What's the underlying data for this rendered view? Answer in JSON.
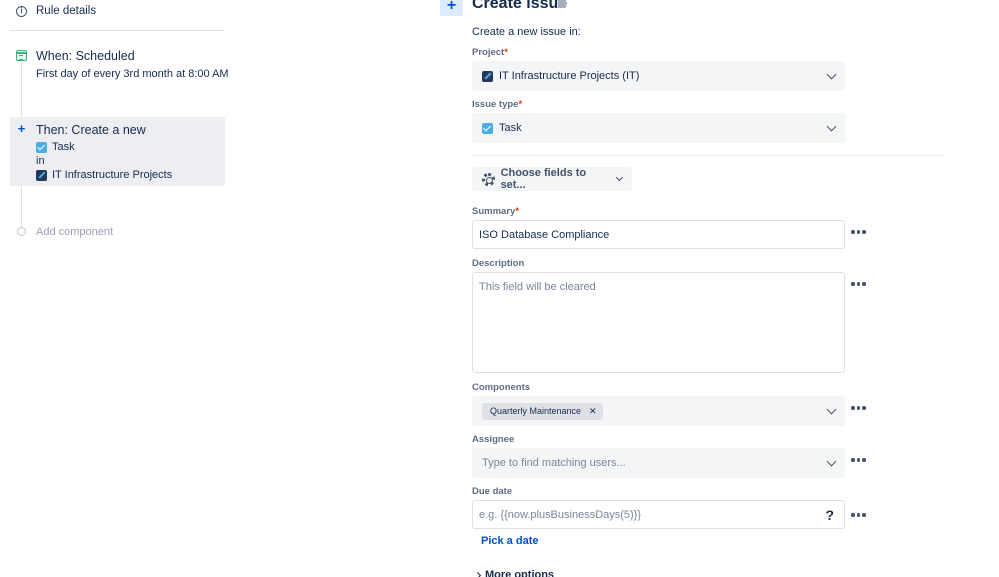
{
  "sidebar": {
    "rule_details": "Rule details",
    "trigger": {
      "title": "When: Scheduled",
      "subtitle": "First day of every 3rd month at 8:00 AM"
    },
    "action": {
      "title": "Then: Create a new",
      "issue_type": "Task",
      "connector": "in",
      "project": "IT Infrastructure Projects"
    },
    "add_component": "Add component"
  },
  "editor": {
    "title": "Create issue",
    "intro": "Create a new issue in:",
    "project": {
      "label": "Project",
      "value": "IT Infrastructure Projects (IT)"
    },
    "issue_type": {
      "label": "Issue type",
      "value": "Task"
    },
    "choose_fields": "Choose fields to set...",
    "summary": {
      "label": "Summary",
      "value": "ISO Database Compliance"
    },
    "description": {
      "label": "Description",
      "placeholder": "This field will be cleared"
    },
    "components": {
      "label": "Components",
      "tags": [
        "Quarterly Maintenance"
      ]
    },
    "assignee": {
      "label": "Assignee",
      "placeholder": "Type to find matching users..."
    },
    "due_date": {
      "label": "Due date",
      "placeholder": "e.g. {{now.plusBusinessDays(5)}}",
      "help": "?"
    },
    "pick_date": "Pick a date",
    "more_options": "More options"
  },
  "required_marker": "*",
  "colors": {
    "accent": "#0052cc",
    "trigger_green": "#36b37e",
    "task_blue": "#4bade8",
    "required_red": "#de350b"
  },
  "icons": [
    "info-icon",
    "calendar-icon",
    "plus-icon",
    "task-icon",
    "project-icon",
    "trash-icon",
    "chevron-down-icon",
    "gear-icon",
    "more-icon",
    "close-icon",
    "help-icon",
    "chevron-right-icon"
  ]
}
